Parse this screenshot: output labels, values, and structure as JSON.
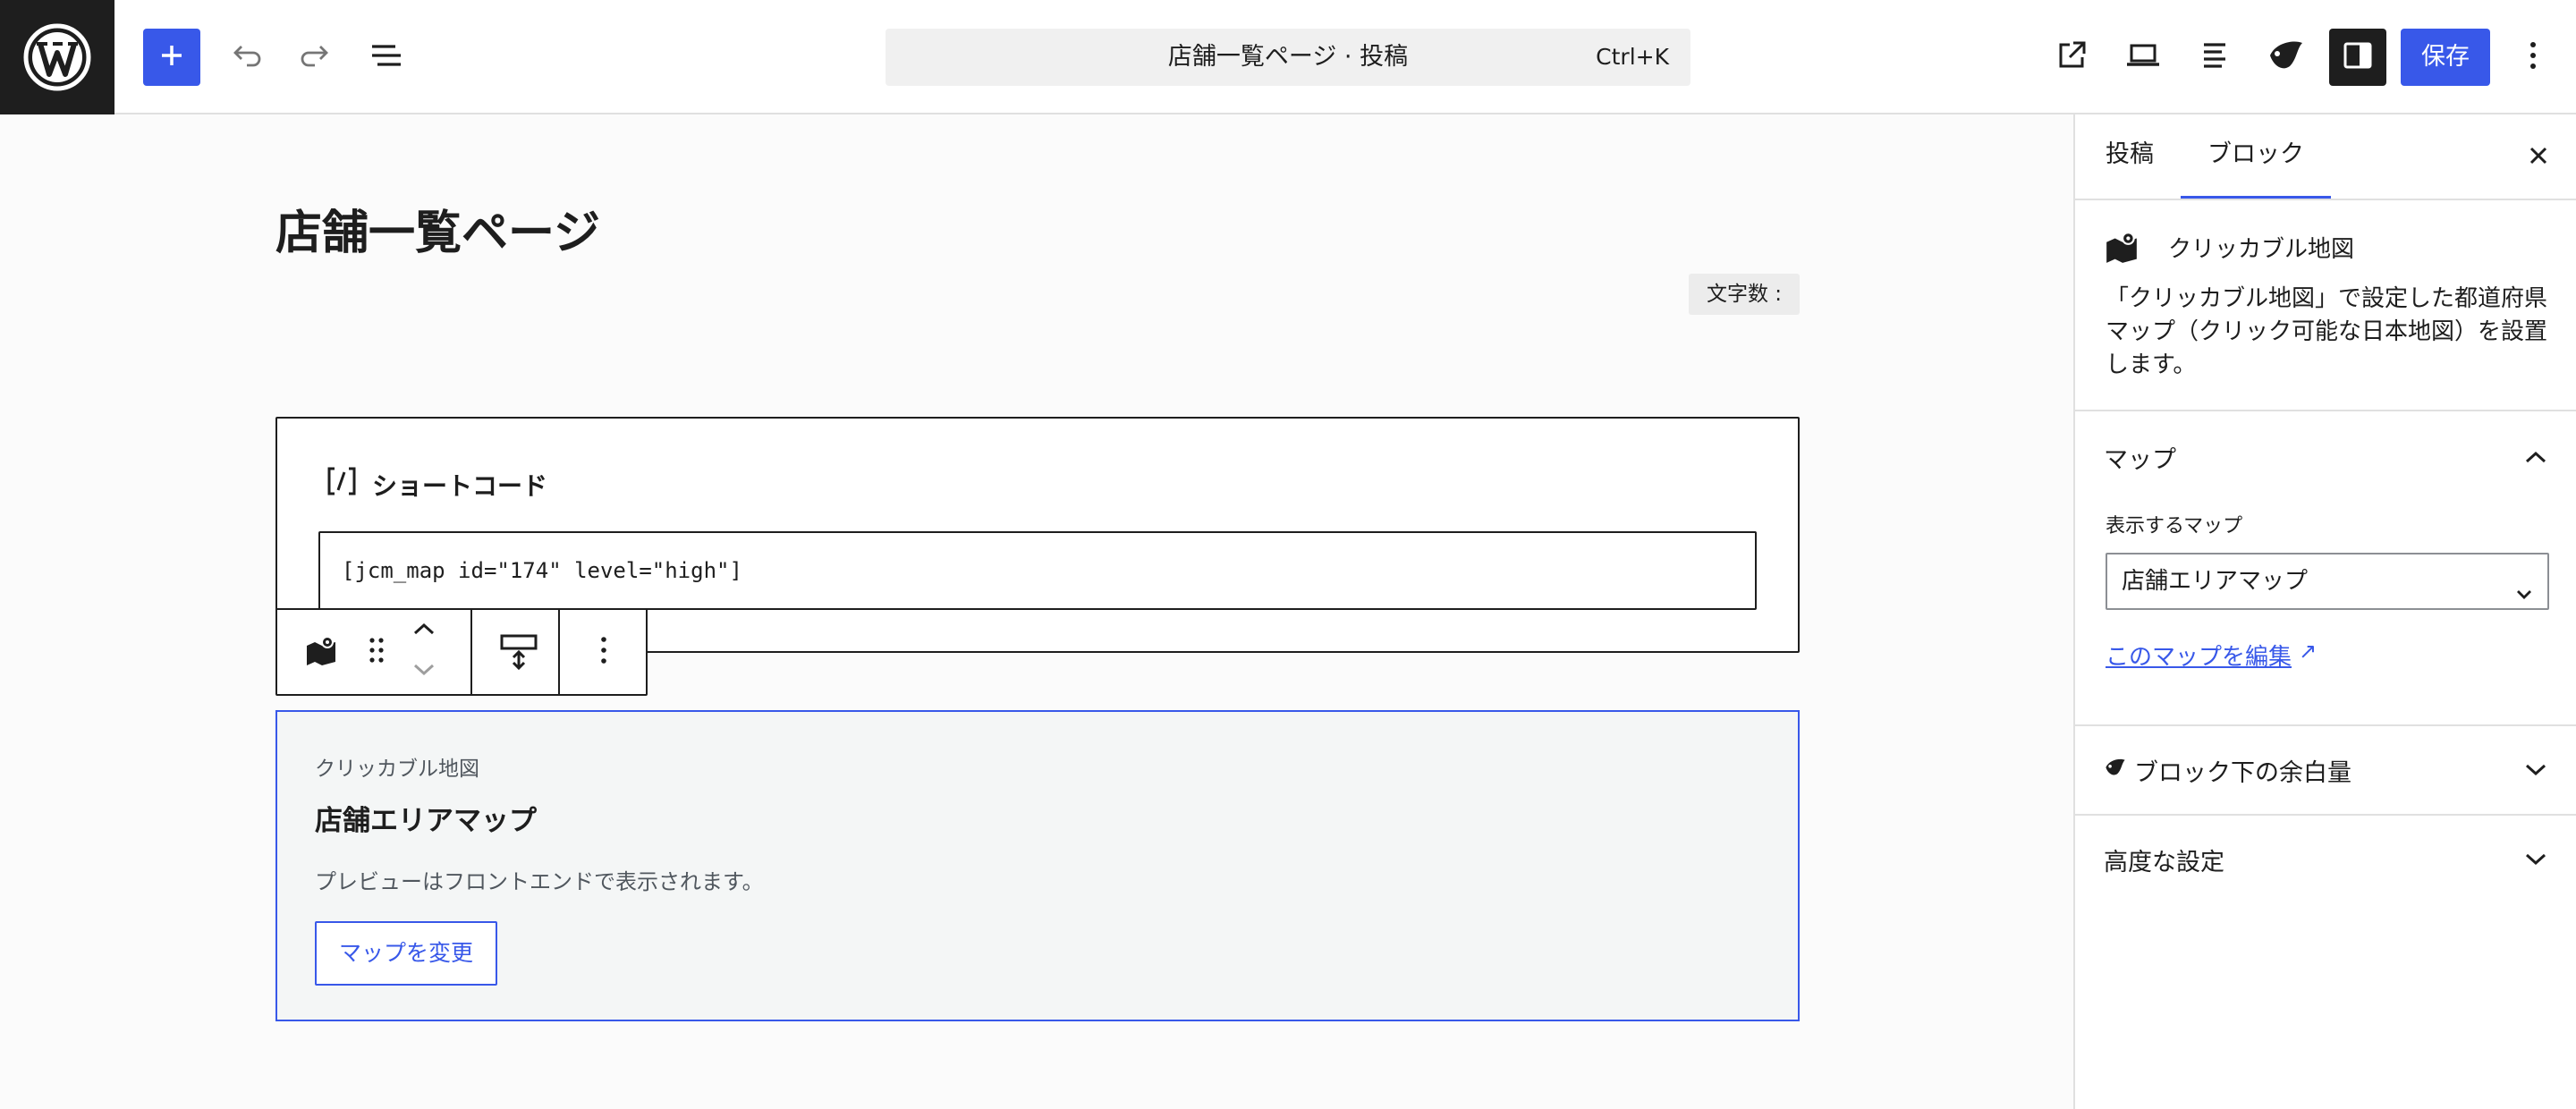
{
  "header": {
    "command_title": "店舗一覧ページ · 投稿",
    "command_shortcut": "Ctrl+K",
    "save_label": "保存"
  },
  "editor": {
    "post_title": "店舗一覧ページ",
    "char_count_label": "文字数 :",
    "shortcode_block": {
      "label": "ショートコード",
      "value": "[jcm_map id=\"174\" level=\"high\"]"
    },
    "map_block": {
      "block_label": "クリッカブル地図",
      "map_title": "店舗エリアマップ",
      "preview_note": "プレビューはフロントエンドで表示されます。",
      "change_button": "マップを変更"
    }
  },
  "sidebar": {
    "tabs": [
      "投稿",
      "ブロック"
    ],
    "active_tab": "ブロック",
    "block_name": "クリッカブル地図",
    "block_description": "「クリッカブル地図」で設定した都道府県マップ（クリック可能な日本地図）を設置します。",
    "panels": {
      "map": {
        "title": "マップ",
        "expanded": true,
        "field_label": "表示するマップ",
        "selected_map": "店舗エリアマップ",
        "edit_link": "このマップを編集",
        "edit_link_icon": "↗"
      },
      "spacing": {
        "title": "ブロック下の余白量",
        "expanded": false
      },
      "advanced": {
        "title": "高度な設定",
        "expanded": false
      }
    }
  },
  "colors": {
    "accent": "#3858e9",
    "dark": "#1e1e1e",
    "muted": "#50575e",
    "border": "#e0e0e0"
  },
  "icons": [
    "wordpress-logo-icon",
    "plus-icon",
    "undo-icon",
    "redo-icon",
    "list-view-icon",
    "external-link-icon",
    "laptop-preview-icon",
    "align-icon",
    "style-icon",
    "sidebar-toggle-icon",
    "more-vertical-icon",
    "map-icon",
    "drag-handle-icon",
    "move-up-icon",
    "move-down-icon",
    "spacing-icon",
    "chevron-up-icon",
    "chevron-down-icon",
    "close-icon"
  ]
}
